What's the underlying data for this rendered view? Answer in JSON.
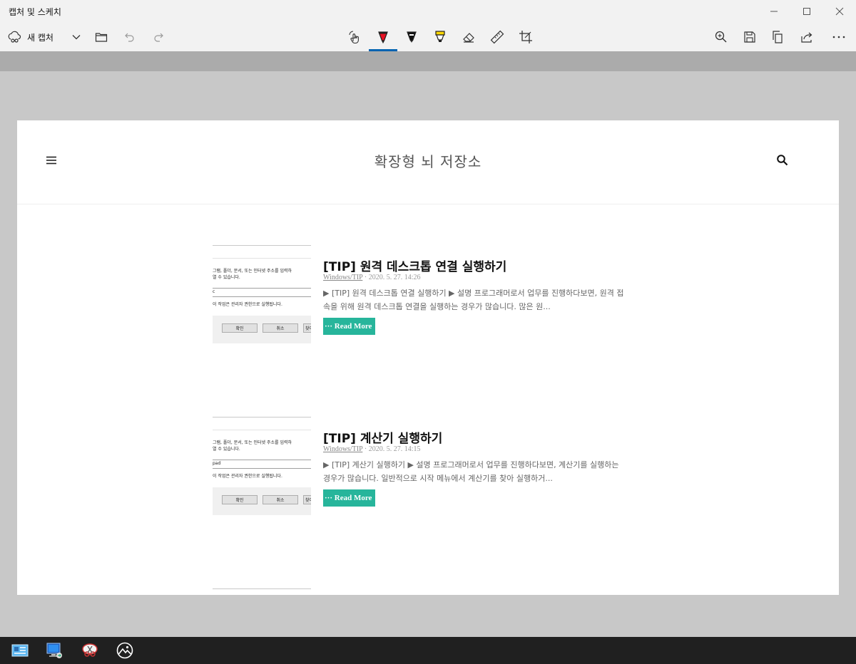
{
  "window": {
    "title": "캡처 및 스케치"
  },
  "toolbar": {
    "new_capture_label": "새 캡처"
  },
  "website": {
    "title": "확장형 뇌 저장소"
  },
  "posts": [
    {
      "title": "[TIP] 원격 데스크톱 연결 실행하기",
      "category": "Windows/TIP",
      "date": "2020. 5. 27. 14:26",
      "excerpt": "▶ [TIP] 원격 데스크톱 연결 실행하기 ▶ 설명 프로그래머로서 업무를 진행하다보면, 원격 접속을 위해 원격 데스크톱 연결을 실행하는 경우가 많습니다. 많은 원...",
      "read_more": "··· Read More",
      "thumb": {
        "text1": "그램, 폴더, 문서, 또는 인터넷 주소를 입력하",
        "text2": "열 수 있습니다.",
        "input": "c",
        "admin": "이 작업은 관리자 권한으로 실행됩니다.",
        "ok": "확인",
        "cancel": "취소",
        "browse": "찾아"
      }
    },
    {
      "title": "[TIP] 계산기 실행하기",
      "category": "Windows/TIP",
      "date": "2020. 5. 27. 14:15",
      "excerpt": "▶ [TIP] 계산기 실행하기 ▶ 설명 프로그래머로서 업무를 진행하다보면, 계산기를 실행하는 경우가 많습니다. 일반적으로 시작 메뉴에서 계산기를 찾아 실행하거...",
      "read_more": "··· Read More",
      "thumb": {
        "text1": "그램, 폴더, 문서, 또는 인터넷 주소를 입력하",
        "text2": "열 수 있습니다.",
        "input": "pad",
        "admin": "이 작업은 관리자 권한으로 실행됩니다.",
        "ok": "확인",
        "cancel": "취소",
        "browse": "찾아"
      }
    }
  ],
  "colors": {
    "accent": "#0063b1",
    "read_more_bg": "#27b59b",
    "taskbar": "#202020"
  }
}
